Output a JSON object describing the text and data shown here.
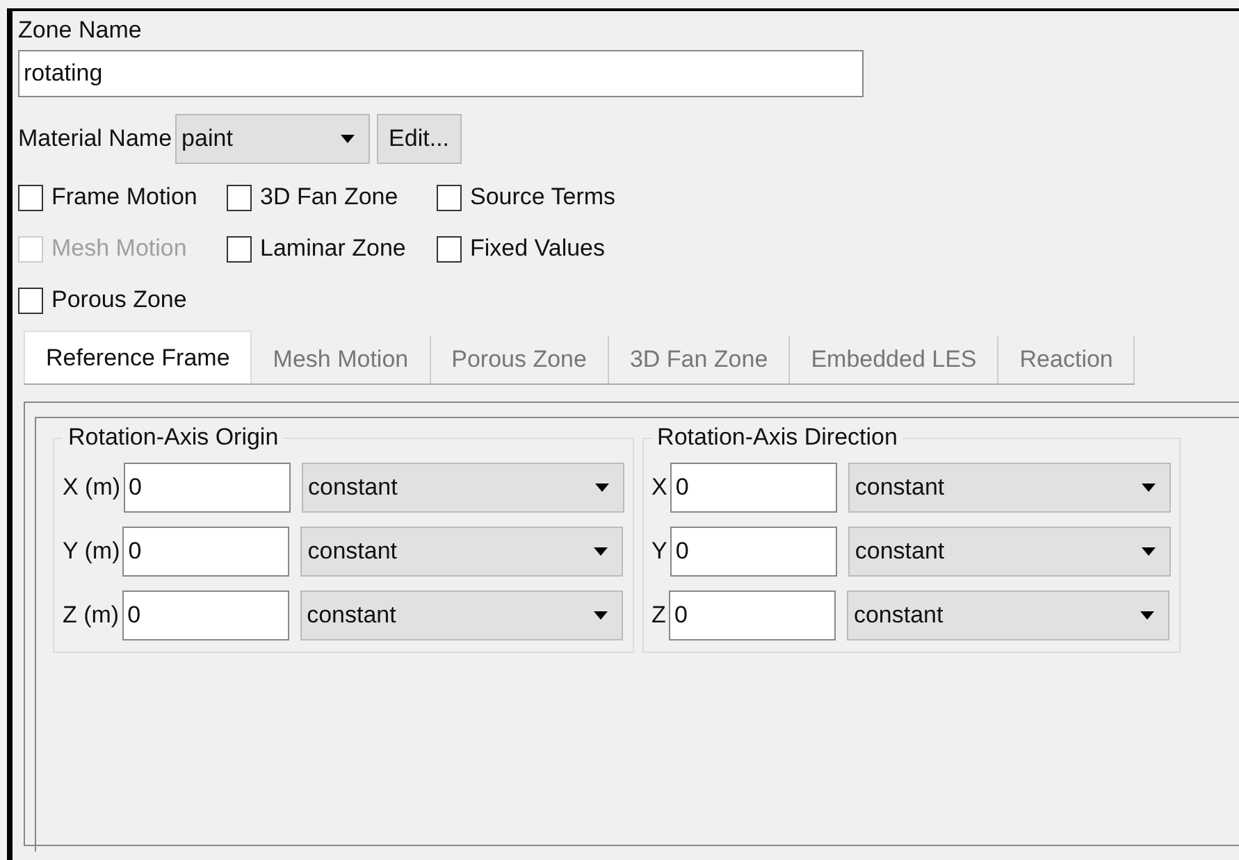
{
  "zone_name": {
    "label": "Zone Name",
    "value": "rotating"
  },
  "material": {
    "label": "Material Name",
    "value": "paint",
    "button": "Edit..."
  },
  "options": [
    {
      "label": "Frame Motion",
      "checked": false,
      "disabled": false
    },
    {
      "label": "3D Fan Zone",
      "checked": false,
      "disabled": false
    },
    {
      "label": "Source Terms",
      "checked": false,
      "disabled": false
    },
    {
      "label": "Mesh Motion",
      "checked": false,
      "disabled": true
    },
    {
      "label": "Laminar Zone",
      "checked": false,
      "disabled": false
    },
    {
      "label": "Fixed Values",
      "checked": false,
      "disabled": false
    },
    {
      "label": "Porous Zone",
      "checked": false,
      "disabled": false
    }
  ],
  "tabs": [
    {
      "label": "Reference Frame",
      "selected": true
    },
    {
      "label": "Mesh Motion",
      "selected": false
    },
    {
      "label": "Porous Zone",
      "selected": false
    },
    {
      "label": "3D Fan Zone",
      "selected": false
    },
    {
      "label": "Embedded LES",
      "selected": false
    },
    {
      "label": "Reaction",
      "selected": false
    }
  ],
  "groups": [
    {
      "title": "Rotation-Axis Origin",
      "rows": [
        {
          "label": "X (m)",
          "value": "0",
          "profile": "constant"
        },
        {
          "label": "Y (m)",
          "value": "0",
          "profile": "constant"
        },
        {
          "label": "Z (m)",
          "value": "0",
          "profile": "constant"
        }
      ]
    },
    {
      "title": "Rotation-Axis Direction",
      "rows": [
        {
          "label": "X",
          "value": "0",
          "profile": "constant"
        },
        {
          "label": "Y",
          "value": "0",
          "profile": "constant"
        },
        {
          "label": "Z",
          "value": "0",
          "profile": "constant"
        }
      ]
    }
  ]
}
